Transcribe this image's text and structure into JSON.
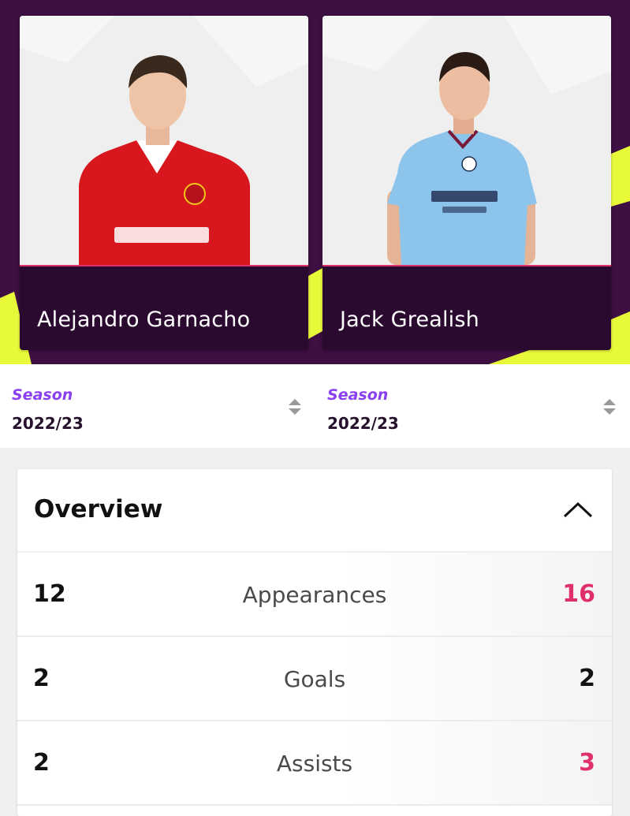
{
  "players": [
    {
      "name": "Alejandro Garnacho",
      "kit_color": "#d8161e",
      "photo": "player-photo-red-kit"
    },
    {
      "name": "Jack Grealish",
      "kit_color": "#8cc4ec",
      "photo": "player-photo-sky-blue-kit"
    }
  ],
  "season_selectors": [
    {
      "label": "Season",
      "value": "2022/23",
      "icon": "sort-arrows-icon"
    },
    {
      "label": "Season",
      "value": "2022/23",
      "icon": "sort-arrows-icon"
    }
  ],
  "overview": {
    "title": "Overview",
    "toggle_icon": "chevron-up-icon",
    "rows": [
      {
        "label": "Appearances",
        "left": "12",
        "right": "16",
        "highlight": "right"
      },
      {
        "label": "Goals",
        "left": "2",
        "right": "2",
        "highlight": "none"
      },
      {
        "label": "Assists",
        "left": "2",
        "right": "3",
        "highlight": "right"
      }
    ]
  },
  "colors": {
    "header_bg": "#3d0f42",
    "name_band": "#2b0a30",
    "accent_pink": "#e0306c",
    "season_purple": "#8a3ff0",
    "lime": "#e8f93a"
  }
}
